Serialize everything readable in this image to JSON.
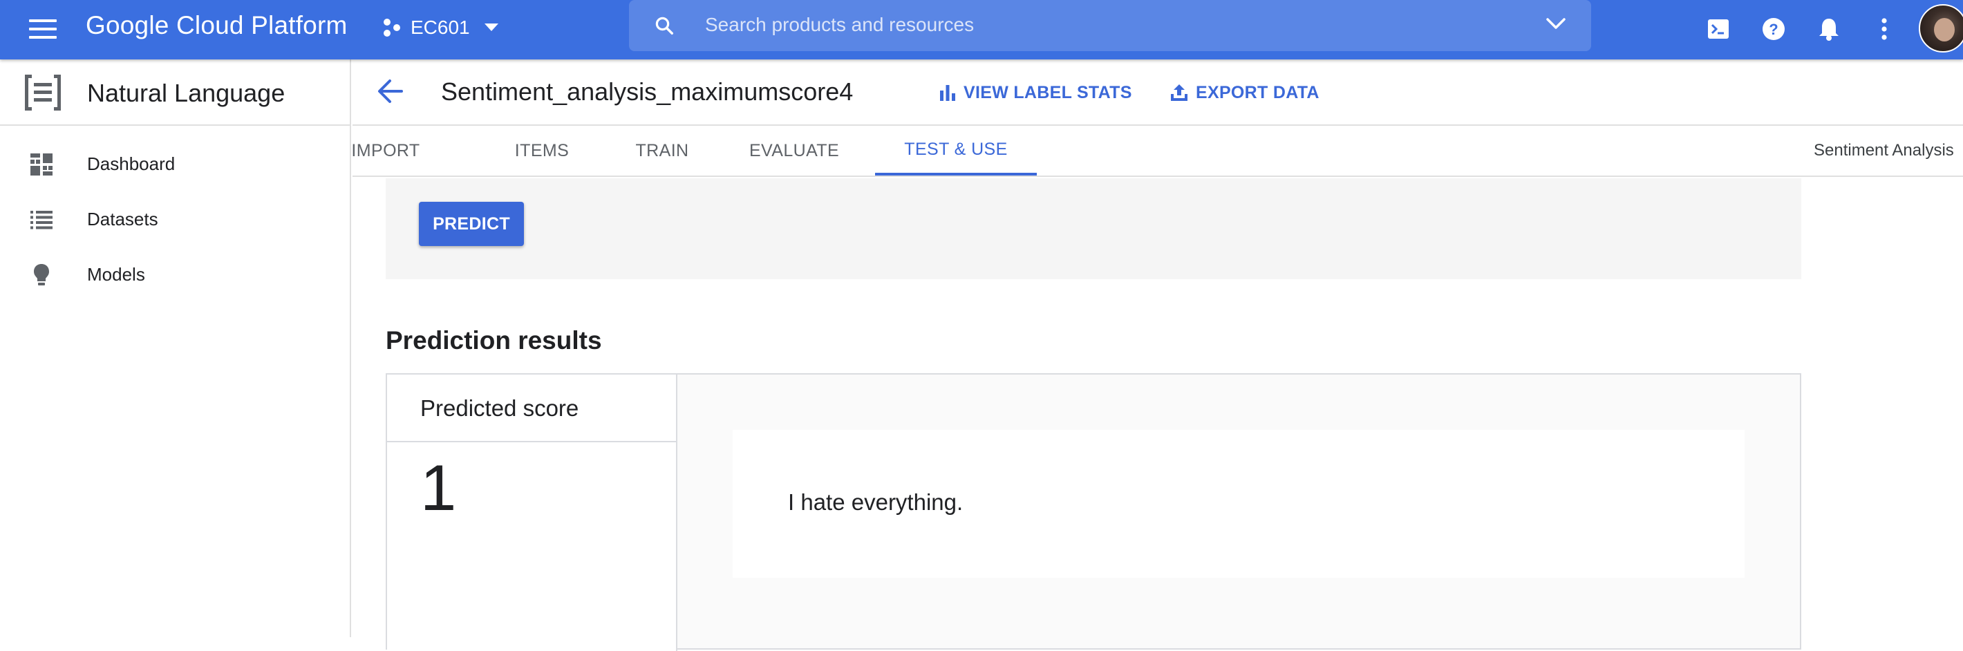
{
  "topbar": {
    "brand": "Google Cloud Platform",
    "project": "EC601",
    "search_placeholder": "Search products and resources",
    "icons": [
      "menu-icon",
      "project-icon",
      "search-icon",
      "chevron-down-icon",
      "cloud-shell-icon",
      "help-icon",
      "notifications-icon",
      "more-vert-icon",
      "avatar"
    ]
  },
  "sidebar": {
    "title": "Natural Language",
    "items": [
      {
        "label": "Dashboard",
        "icon": "dashboard-icon"
      },
      {
        "label": "Datasets",
        "icon": "list-icon"
      },
      {
        "label": "Models",
        "icon": "lightbulb-icon"
      }
    ]
  },
  "header": {
    "dataset_title": "Sentiment_analysis_maximumscore4",
    "view_label_stats": "VIEW LABEL STATS",
    "export_data": "EXPORT DATA"
  },
  "tabs": [
    {
      "label": "IMPORT",
      "active": false
    },
    {
      "label": "ITEMS",
      "active": false
    },
    {
      "label": "TRAIN",
      "active": false
    },
    {
      "label": "EVALUATE",
      "active": false
    },
    {
      "label": "TEST & USE",
      "active": true
    }
  ],
  "tab_right_label": "Sentiment Analysis",
  "predict": {
    "button_label": "PREDICT"
  },
  "results": {
    "title": "Prediction results",
    "score_header": "Predicted score",
    "score_value": "1",
    "input_text": "I hate everything."
  },
  "colors": {
    "topbar": "#3b6fe0",
    "accent": "#3b68d8",
    "panel": "#f5f5f5"
  }
}
